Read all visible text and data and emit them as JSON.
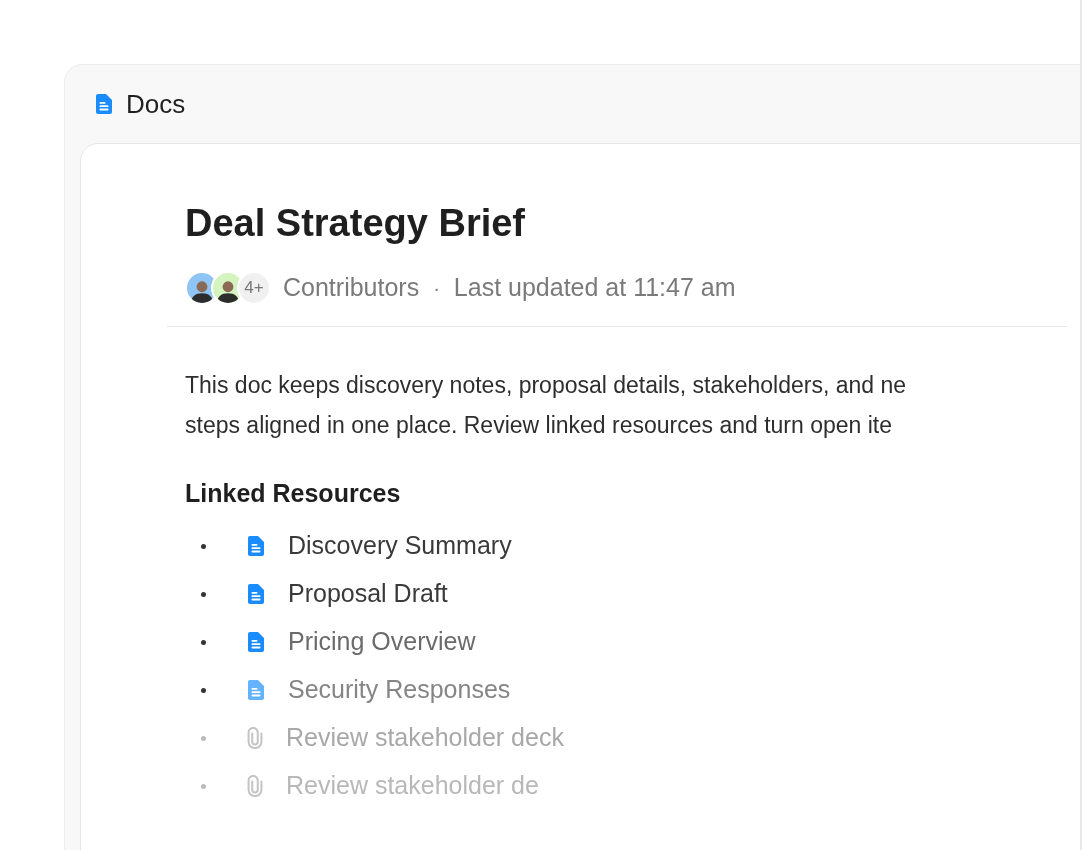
{
  "panel": {
    "title": "Docs"
  },
  "doc": {
    "title": "Deal Strategy Brief",
    "contributors": {
      "avatars": [
        {
          "color": "#8ec5f5"
        },
        {
          "color": "#d4f3bf"
        }
      ],
      "more": "4+",
      "label": "Contributors"
    },
    "separator": "·",
    "updated": "Last updated at 11:47 am",
    "body_lines": [
      "This doc keeps discovery notes, proposal details, stakeholders, and ne",
      "steps aligned in one place. Review linked resources and turn open ite"
    ],
    "section_title": "Linked Resources",
    "resources": [
      {
        "kind": "doc",
        "label": "Discovery Summary"
      },
      {
        "kind": "doc",
        "label": "Proposal Draft"
      },
      {
        "kind": "doc",
        "label": "Pricing Overview"
      },
      {
        "kind": "doc",
        "label": "Security Responses"
      },
      {
        "kind": "attachment",
        "label": "Review stakeholder deck"
      },
      {
        "kind": "attachment",
        "label": "Review stakeholder de"
      }
    ]
  }
}
